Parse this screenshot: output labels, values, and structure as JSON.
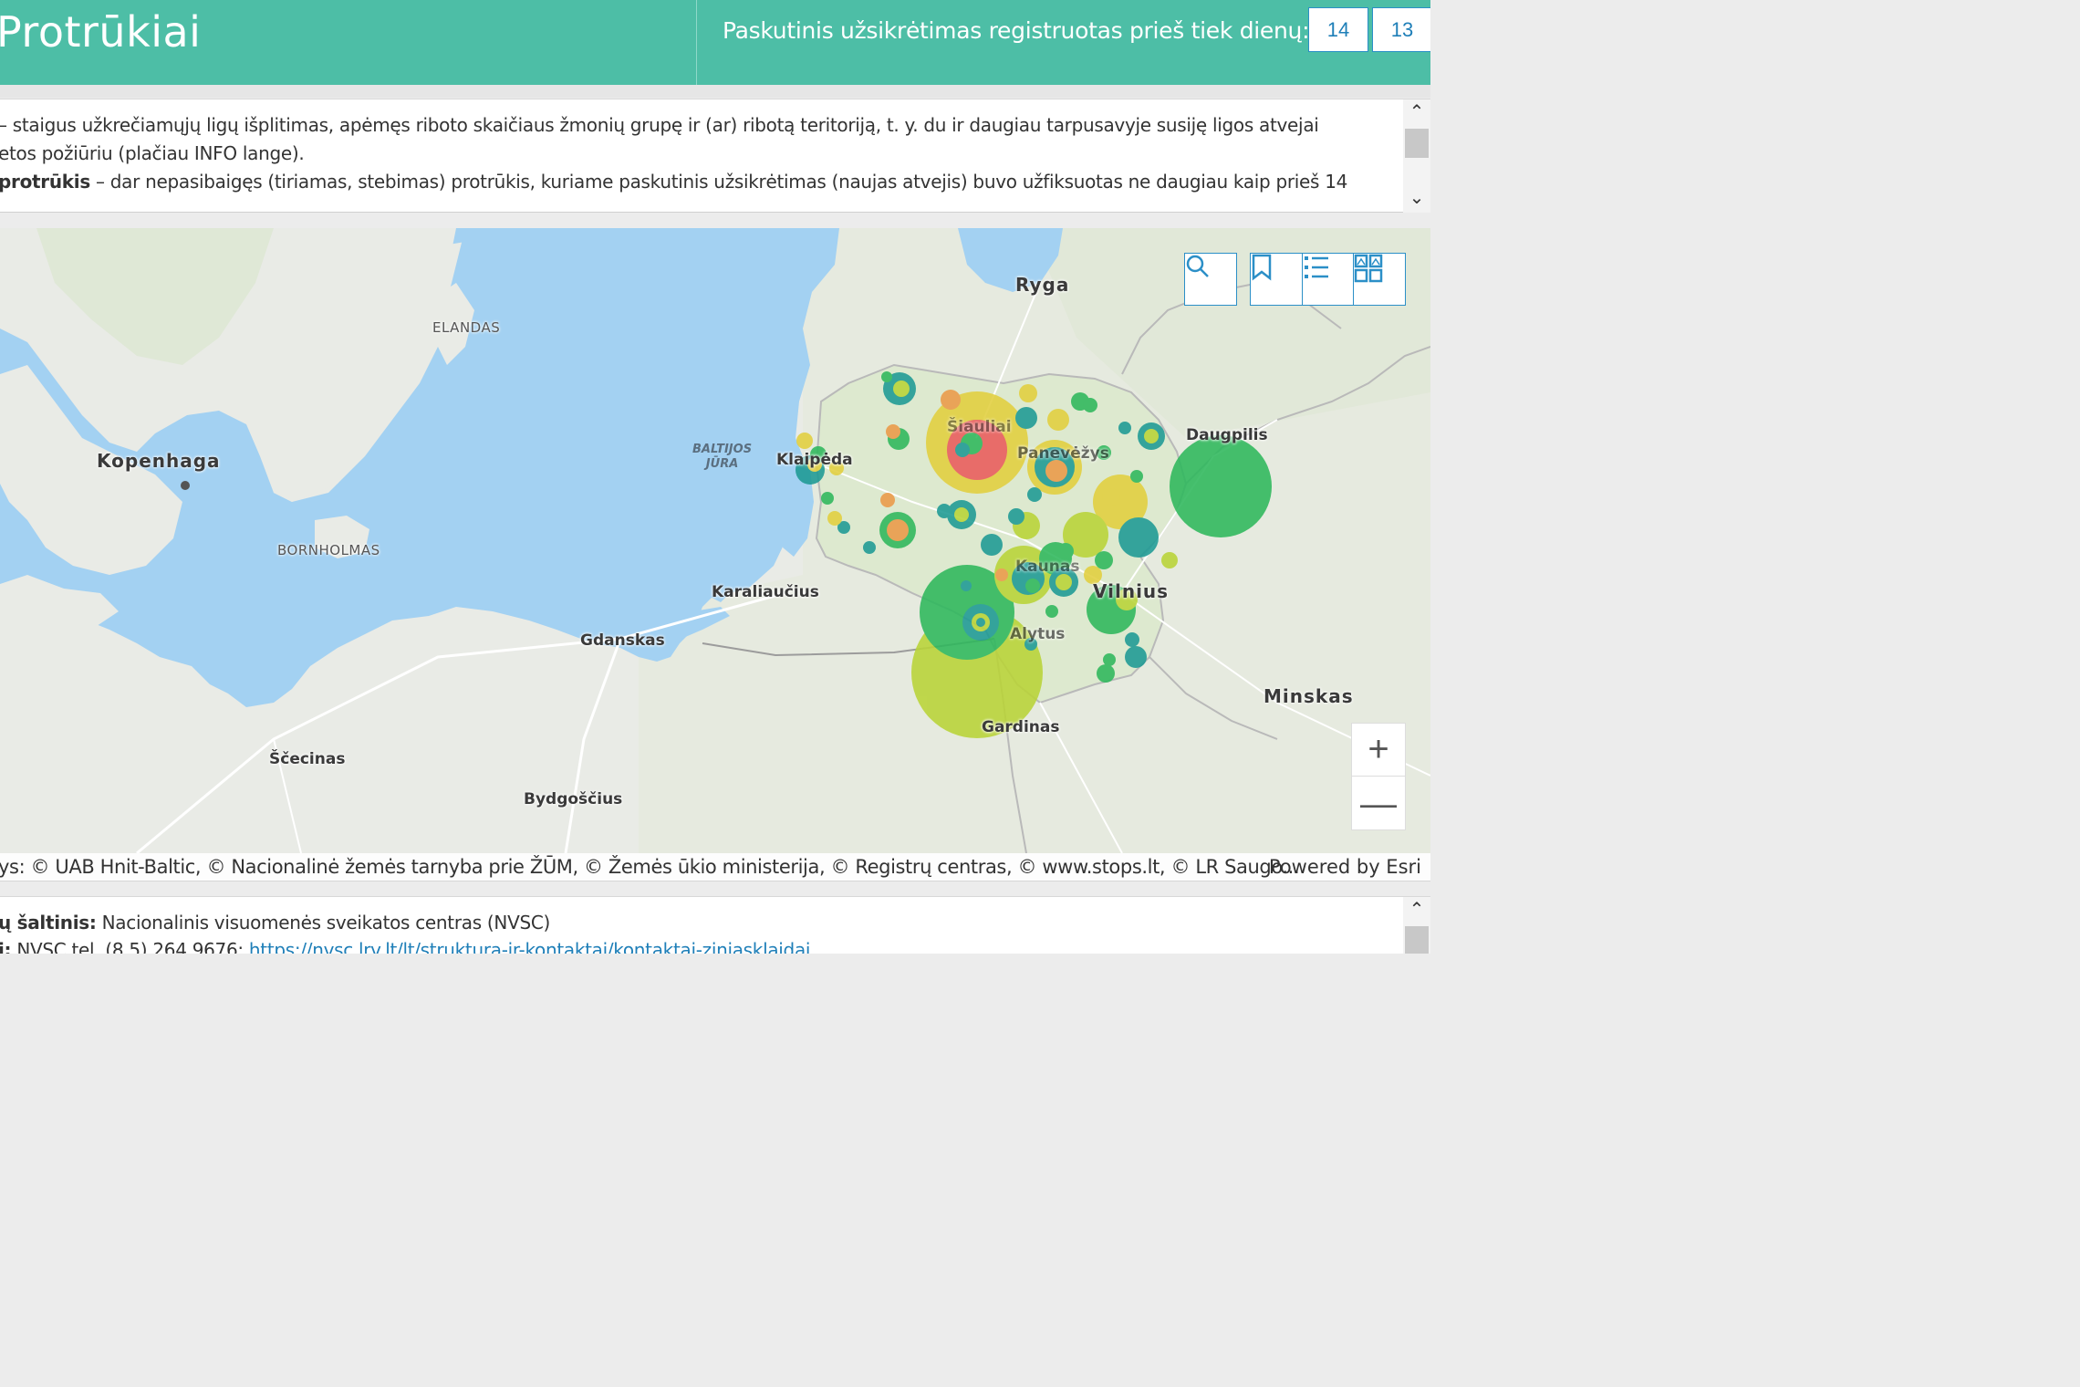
{
  "header": {
    "title": "Protrūkiai",
    "days_label": "Paskutinis užsikrėtimas registruotas prieš tiek dienų:",
    "day_options": [
      "14",
      "13"
    ]
  },
  "description": {
    "line1": "– staigus užkrečiamųjų ligų išplitimas, apėmęs riboto skaičiaus žmonių grupę ir (ar) ribotą teritoriją, t. y. du ir daugiau tarpusavyje susiję ligos atvejai",
    "line2": "etos požiūriu (plačiau INFO lange).",
    "line3_bold": "protrūkis",
    "line3_rest": " – dar nepasibaigęs (tiriamas, stebimas) protrūkis, kuriame paskutinis užsikrėtimas (naujas atvejis) buvo užfiksuotas ne daugiau kaip prieš 14"
  },
  "map": {
    "labels": {
      "ryga": "Ryga",
      "elandas": "ELANDAS",
      "kopenhaga": "Kopenhaga",
      "baltijos_jura": "BALTIJOS\nJŪRA",
      "klaipeda": "Klaipėda",
      "siauliai": "Šiauliai",
      "panevezys": "Panevėžys",
      "daugpilis": "Daugpilis",
      "bornholmas": "BORNHOLMAS",
      "karaliaucius": "Karaliaučius",
      "kaunas": "Kaunas",
      "vilnius": "Vilnius",
      "gdanskas": "Gdanskas",
      "alytus": "Alytus",
      "minskas": "Minskas",
      "gardinas": "Gardinas",
      "scecinas": "Ščecinas",
      "bydgoscius": "Bydgoščius"
    },
    "tools": [
      "search-icon",
      "bookmark-icon",
      "layer-list-icon",
      "basemap-gallery-icon"
    ],
    "zoom_in": "+",
    "zoom_out": "—"
  },
  "attribution": {
    "text": "ys: © UAB Hnit-Baltic, © Nacionalinė žemės tarnyba prie ŽŪM, © Žemės ūkio ministerija, © Registrų centras, © www.stops.lt, © LR Saugo...",
    "powered": "Powered by Esri"
  },
  "source": {
    "line1_bold": "ų šaltinis:",
    "line1_rest": " Nacionalinis visuomenės sveikatos centras (NVSC)",
    "line2_bold": "i:",
    "line2_rest": " NVSC tel. (8 5) 264 9676; ",
    "line2_link": "https://nvsc.lrv.lt/lt/struktura-ir-kontaktai/kontaktai-ziniasklaidai"
  },
  "colors": {
    "header_bg": "#4dbea6",
    "accent_blue": "#2b8fc7",
    "water": "#a3d1f2",
    "land": "#e9ebe6",
    "bubble_green": "#2eb85c",
    "bubble_lime": "#b9d437",
    "bubble_yellow": "#e2cf3e",
    "bubble_orange": "#eb9a48",
    "bubble_red": "#ea5b5b",
    "bubble_teal": "#1d9a94"
  }
}
